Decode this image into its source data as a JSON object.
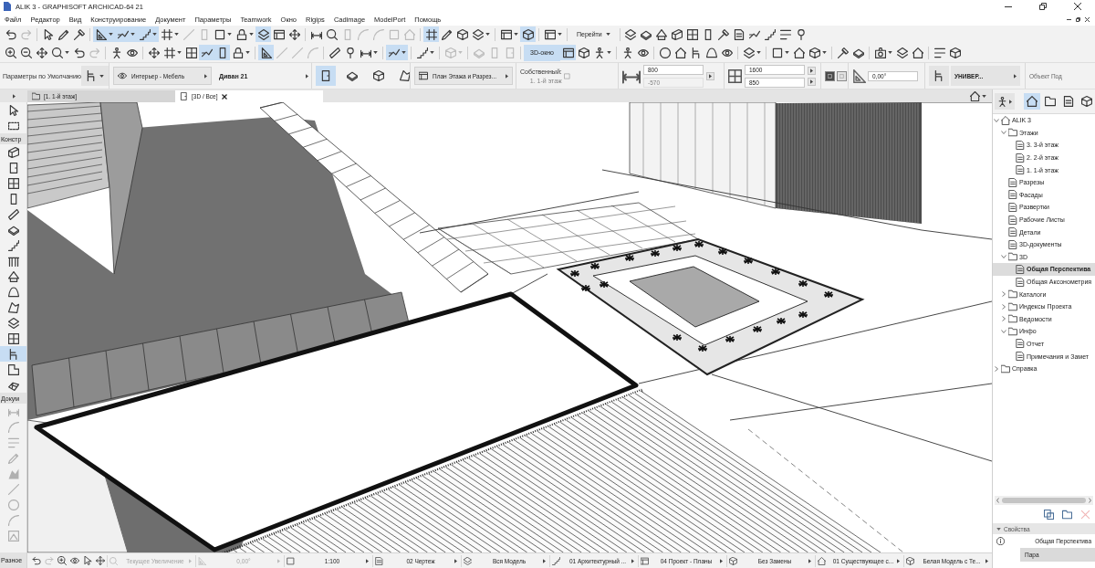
{
  "window": {
    "title": "ALIK 3 - GRAPHISOFT ARCHICAD-64 21"
  },
  "menu": [
    "Файл",
    "Редактор",
    "Вид",
    "Конструирование",
    "Документ",
    "Параметры",
    "Teamwork",
    "Окно",
    "Rigips",
    "Cadimage",
    "ModelPort",
    "Помощь"
  ],
  "toolbar_1": {
    "left": [
      {
        "on": false,
        "disabled": false
      },
      {
        "on": false,
        "disabled": true
      },
      {
        "on": false,
        "disabled": false
      },
      {
        "on": false,
        "disabled": false
      },
      {
        "on": false,
        "disabled": false
      },
      {
        "on": true,
        "disabled": false
      },
      {
        "on": true,
        "disabled": false
      },
      {
        "on": true,
        "disabled": false
      },
      {
        "on": false,
        "disabled": false
      },
      {
        "on": false,
        "disabled": true
      },
      {
        "on": false,
        "disabled": true
      },
      {
        "on": false,
        "disabled": false
      },
      {
        "on": false,
        "disabled": false
      },
      {
        "on": true,
        "disabled": false
      },
      {
        "on": false,
        "disabled": false
      },
      {
        "on": false,
        "disabled": false
      },
      {
        "on": false,
        "disabled": false
      },
      {
        "on": false,
        "disabled": false
      },
      {
        "on": false,
        "disabled": true
      },
      {
        "on": false,
        "disabled": true
      },
      {
        "on": false,
        "disabled": true
      },
      {
        "on": false,
        "disabled": true
      },
      {
        "on": false,
        "disabled": true
      },
      {
        "on": true,
        "disabled": false
      },
      {
        "on": false,
        "disabled": false
      },
      {
        "on": false,
        "disabled": false
      },
      {
        "on": false,
        "disabled": false
      },
      {
        "on": false,
        "disabled": false
      },
      {
        "on": true,
        "disabled": false
      },
      {
        "on": false,
        "disabled": false
      }
    ],
    "goto": "Перейти",
    "right": [
      {
        "on": false,
        "disabled": false
      },
      {
        "on": false,
        "disabled": false
      },
      {
        "on": false,
        "disabled": false
      },
      {
        "on": false,
        "disabled": false
      },
      {
        "on": false,
        "disabled": false
      },
      {
        "on": false,
        "disabled": false
      },
      {
        "on": false,
        "disabled": false
      },
      {
        "on": false,
        "disabled": false
      },
      {
        "on": false,
        "disabled": false
      },
      {
        "on": false,
        "disabled": false
      },
      {
        "on": false,
        "disabled": false
      },
      {
        "on": false,
        "disabled": false
      }
    ]
  },
  "toolbar_2": {
    "left": [
      {
        "on": false,
        "disabled": false
      },
      {
        "on": false,
        "disabled": false
      },
      {
        "on": false,
        "disabled": false
      },
      {
        "on": false,
        "disabled": false
      },
      {
        "on": false,
        "disabled": false
      },
      {
        "on": false,
        "disabled": true
      },
      {
        "on": false,
        "disabled": false
      },
      {
        "on": false,
        "disabled": false
      },
      {
        "on": false,
        "disabled": false
      },
      {
        "on": false,
        "disabled": false
      },
      {
        "on": false,
        "disabled": false
      },
      {
        "on": true,
        "disabled": false
      },
      {
        "on": true,
        "disabled": false
      },
      {
        "on": false,
        "disabled": false
      },
      {
        "on": true,
        "disabled": false
      },
      {
        "on": false,
        "disabled": true
      },
      {
        "on": false,
        "disabled": true
      },
      {
        "on": false,
        "disabled": true
      },
      {
        "on": false,
        "disabled": false
      },
      {
        "on": false,
        "disabled": false
      },
      {
        "on": false,
        "disabled": false
      },
      {
        "on": true,
        "disabled": false
      },
      {
        "on": false,
        "disabled": false
      },
      {
        "on": false,
        "disabled": true
      },
      {
        "on": false,
        "disabled": true
      },
      {
        "on": false,
        "disabled": true
      },
      {
        "on": false,
        "disabled": true
      }
    ],
    "view_button": {
      "label": "3D-окно",
      "on": true
    },
    "right": [
      {
        "on": true,
        "disabled": false
      },
      {
        "on": false,
        "disabled": false
      },
      {
        "on": false,
        "disabled": false
      },
      {
        "on": false,
        "disabled": false
      },
      {
        "on": false,
        "disabled": false
      },
      {
        "on": false,
        "disabled": false
      },
      {
        "on": false,
        "disabled": false
      },
      {
        "on": false,
        "disabled": false
      },
      {
        "on": false,
        "disabled": false
      },
      {
        "on": false,
        "disabled": false
      },
      {
        "on": false,
        "disabled": false
      },
      {
        "on": false,
        "disabled": false
      },
      {
        "on": false,
        "disabled": false
      },
      {
        "on": false,
        "disabled": false
      },
      {
        "on": false,
        "disabled": false
      },
      {
        "on": false,
        "disabled": false
      },
      {
        "on": false,
        "disabled": false
      },
      {
        "on": false,
        "disabled": false
      },
      {
        "on": false,
        "disabled": false
      },
      {
        "on": false,
        "disabled": false
      },
      {
        "on": false,
        "disabled": false
      }
    ]
  },
  "info_box": {
    "preset_label": "Параметры по Умолчанию",
    "layer": "Интерьер - Мебель",
    "object_name": "Диван 21",
    "display_modes": [
      {
        "selected": true
      },
      {
        "selected": false
      },
      {
        "selected": false
      },
      {
        "selected": false
      }
    ],
    "plan_display": "План Этажа и Разрез...",
    "own_label": "Собственный:",
    "story": "1. 1-й этаж",
    "elevations": [
      {
        "value": "800",
        "disabled": false
      },
      {
        "value": "-570",
        "disabled": true
      }
    ],
    "sizes": [
      {
        "value": "1600",
        "disabled": false
      },
      {
        "value": "850",
        "disabled": false
      }
    ],
    "mirror_toggles": [
      {
        "on": true
      },
      {
        "on": false
      }
    ],
    "angle": "0,00°",
    "preset_button": "УНИВЕР...",
    "panel_label": "Объект Под"
  },
  "tabs": [
    {
      "label": "[1. 1-й этаж]",
      "selected": false
    },
    {
      "label": "[3D / Все]",
      "selected": true
    }
  ],
  "toolbox": {
    "top": [
      {
        "selected": false,
        "disabled": false
      },
      {
        "selected": false,
        "disabled": false
      }
    ],
    "sections": [
      {
        "label": "Констр",
        "tools": [
          {
            "selected": false,
            "disabled": false
          },
          {
            "selected": false,
            "disabled": false
          },
          {
            "selected": false,
            "disabled": false
          },
          {
            "selected": false,
            "disabled": false
          },
          {
            "selected": false,
            "disabled": false
          },
          {
            "selected": false,
            "disabled": false
          },
          {
            "selected": false,
            "disabled": false
          },
          {
            "selected": false,
            "disabled": false
          },
          {
            "selected": false,
            "disabled": false
          },
          {
            "selected": false,
            "disabled": false
          },
          {
            "selected": false,
            "disabled": false
          },
          {
            "selected": false,
            "disabled": false
          },
          {
            "selected": false,
            "disabled": false
          },
          {
            "selected": true,
            "disabled": false
          },
          {
            "selected": false,
            "disabled": false
          },
          {
            "selected": false,
            "disabled": false
          }
        ]
      },
      {
        "label": "Докум",
        "tools": [
          {
            "selected": false,
            "disabled": true
          },
          {
            "selected": false,
            "disabled": true
          },
          {
            "selected": false,
            "disabled": true
          },
          {
            "selected": false,
            "disabled": true
          },
          {
            "selected": false,
            "disabled": true
          },
          {
            "selected": false,
            "disabled": true
          },
          {
            "selected": false,
            "disabled": true
          },
          {
            "selected": false,
            "disabled": true
          },
          {
            "selected": false,
            "disabled": true
          }
        ]
      },
      {
        "label": "Разное"
      }
    ]
  },
  "navigator": {
    "map_buttons": [
      {
        "selected": true
      },
      {
        "selected": false
      },
      {
        "selected": false
      },
      {
        "selected": false
      }
    ],
    "tree": [
      {
        "label": "ALIK 3",
        "expanded": true,
        "selected": false,
        "children": [
          {
            "label": "Этажи",
            "expanded": true,
            "selected": false,
            "children": [
              {
                "label": "3. 3-й этаж",
                "selected": false
              },
              {
                "label": "2. 2-й этаж",
                "selected": false
              },
              {
                "label": "1. 1-й этаж",
                "selected": false
              }
            ]
          },
          {
            "label": "Разрезы",
            "selected": false
          },
          {
            "label": "Фасады",
            "selected": false
          },
          {
            "label": "Развертки",
            "selected": false
          },
          {
            "label": "Рабочие Листы",
            "selected": false
          },
          {
            "label": "Детали",
            "selected": false
          },
          {
            "label": "3D-документы",
            "selected": false
          },
          {
            "label": "3D",
            "expanded": true,
            "selected": false,
            "children": [
              {
                "label": "Общая Перспектива",
                "selected": true
              },
              {
                "label": "Общая Аксонометрия",
                "selected": false
              }
            ]
          },
          {
            "label": "Каталоги",
            "expanded": false,
            "selected": false
          },
          {
            "label": "Индексы Проекта",
            "expanded": false,
            "selected": false
          },
          {
            "label": "Ведомости",
            "expanded": false,
            "selected": false
          },
          {
            "label": "Инфо",
            "expanded": true,
            "selected": false,
            "children": [
              {
                "label": "Отчет",
                "selected": false
              },
              {
                "label": "Примечания и Замет",
                "selected": false
              }
            ]
          }
        ]
      },
      {
        "label": "Справка",
        "expanded": false,
        "selected": false
      }
    ],
    "actions": [
      {
        "disabled": false
      },
      {
        "disabled": false
      },
      {
        "disabled": true
      }
    ],
    "properties": {
      "title": "Свойства",
      "expanded": true,
      "view_name": "Общая Перспектива",
      "button": "Пара"
    }
  },
  "status_bar": {
    "nav_buttons": [
      {
        "disabled": false
      },
      {
        "disabled": true
      },
      {
        "disabled": false
      },
      {
        "disabled": false
      },
      {
        "disabled": false
      },
      {
        "disabled": false
      }
    ],
    "fields": [
      {
        "value": "Текущее Увеличение",
        "disabled": true
      },
      {
        "value": "0,00°",
        "disabled": true
      },
      {
        "value": "1:100",
        "disabled": false
      },
      {
        "value": "02 Чертеж",
        "disabled": false
      },
      {
        "value": "Вся Модель",
        "disabled": false
      },
      {
        "value": "01 Архитектурный ...",
        "disabled": false
      },
      {
        "value": "04 Проект - Планы",
        "disabled": false
      },
      {
        "value": "Без Замены",
        "disabled": false
      },
      {
        "value": "01 Существующее с...",
        "disabled": false
      },
      {
        "value": "Белая Модель с Те...",
        "disabled": false
      }
    ]
  }
}
